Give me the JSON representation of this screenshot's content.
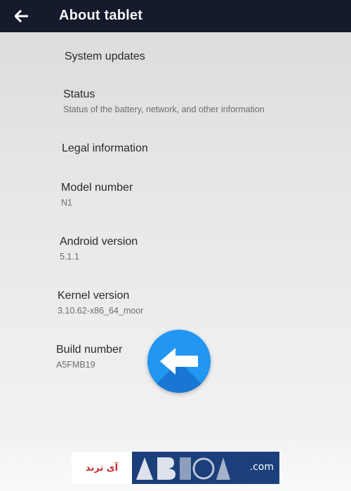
{
  "header": {
    "title": "About tablet",
    "back_icon": "arrow-left-icon"
  },
  "settings": {
    "items": [
      {
        "title": "System updates",
        "subtitle": ""
      },
      {
        "title": "Status",
        "subtitle": "Status of the battery, network, and other information"
      },
      {
        "title": "Legal information",
        "subtitle": ""
      },
      {
        "title": "Model number",
        "subtitle": "N1"
      },
      {
        "title": "Android version",
        "subtitle": "5.1.1"
      },
      {
        "title": "Kernel version",
        "subtitle": "3.10.62-x86_64_moor"
      },
      {
        "title": "Build number",
        "subtitle": "A5FMB19"
      }
    ]
  },
  "overlay": {
    "icon": "arrow-left-icon",
    "color": "#2196f3"
  },
  "watermark": {
    "arabic_text": "آی ترند",
    "suffix": ".com"
  },
  "colors": {
    "appbar": "#151a2c",
    "accent": "#2196f3"
  }
}
